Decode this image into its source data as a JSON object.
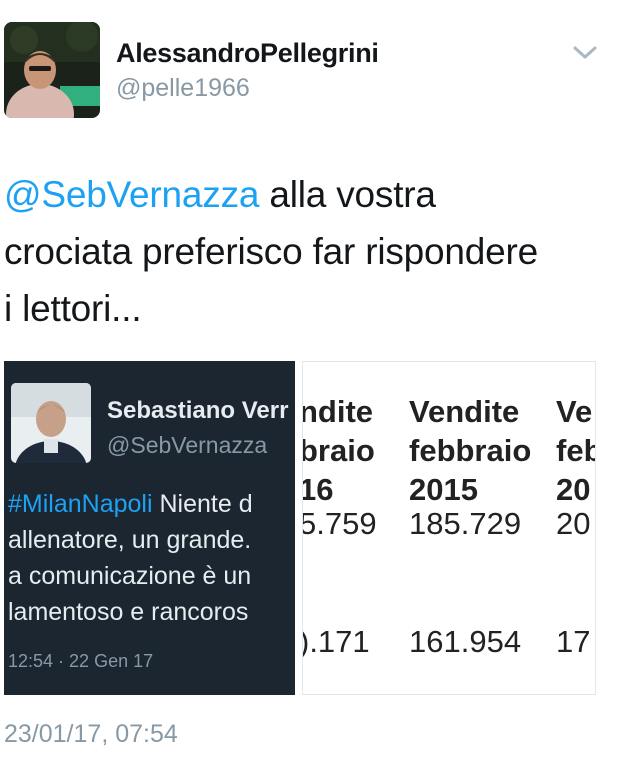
{
  "header": {
    "name": "AlessandroPellegrini",
    "handle": "@pelle1966"
  },
  "tweet": {
    "mention": "@SebVernazza",
    "text_line1": " alla vostra",
    "text_line2": "crociata preferisco far rispondere",
    "text_line3": "i lettori..."
  },
  "embedded_tweet": {
    "name": "Sebastiano Verr",
    "handle": "@SebVernazza",
    "hashtag": "#MilanNapoli",
    "line1_rest": " Niente d",
    "line2": "allenatore, un grande.",
    "line3": "a comunicazione è un",
    "line4": "lamentoso e rancoros",
    "time": "12:54 · 22 Gen 17"
  },
  "table": {
    "columns": [
      {
        "h1": "ndite",
        "h2": "braio",
        "h3": "16",
        "v1": "5.759",
        "v2": ").171"
      },
      {
        "h1": "Vendite",
        "h2": "febbraio",
        "h3": "2015",
        "v1": "185.729",
        "v2": "161.954"
      },
      {
        "h1": "Ve",
        "h2": "feb",
        "h3": "20",
        "v1": "20",
        "v2": "17"
      }
    ]
  },
  "timestamp": "23/01/17, 07:54"
}
